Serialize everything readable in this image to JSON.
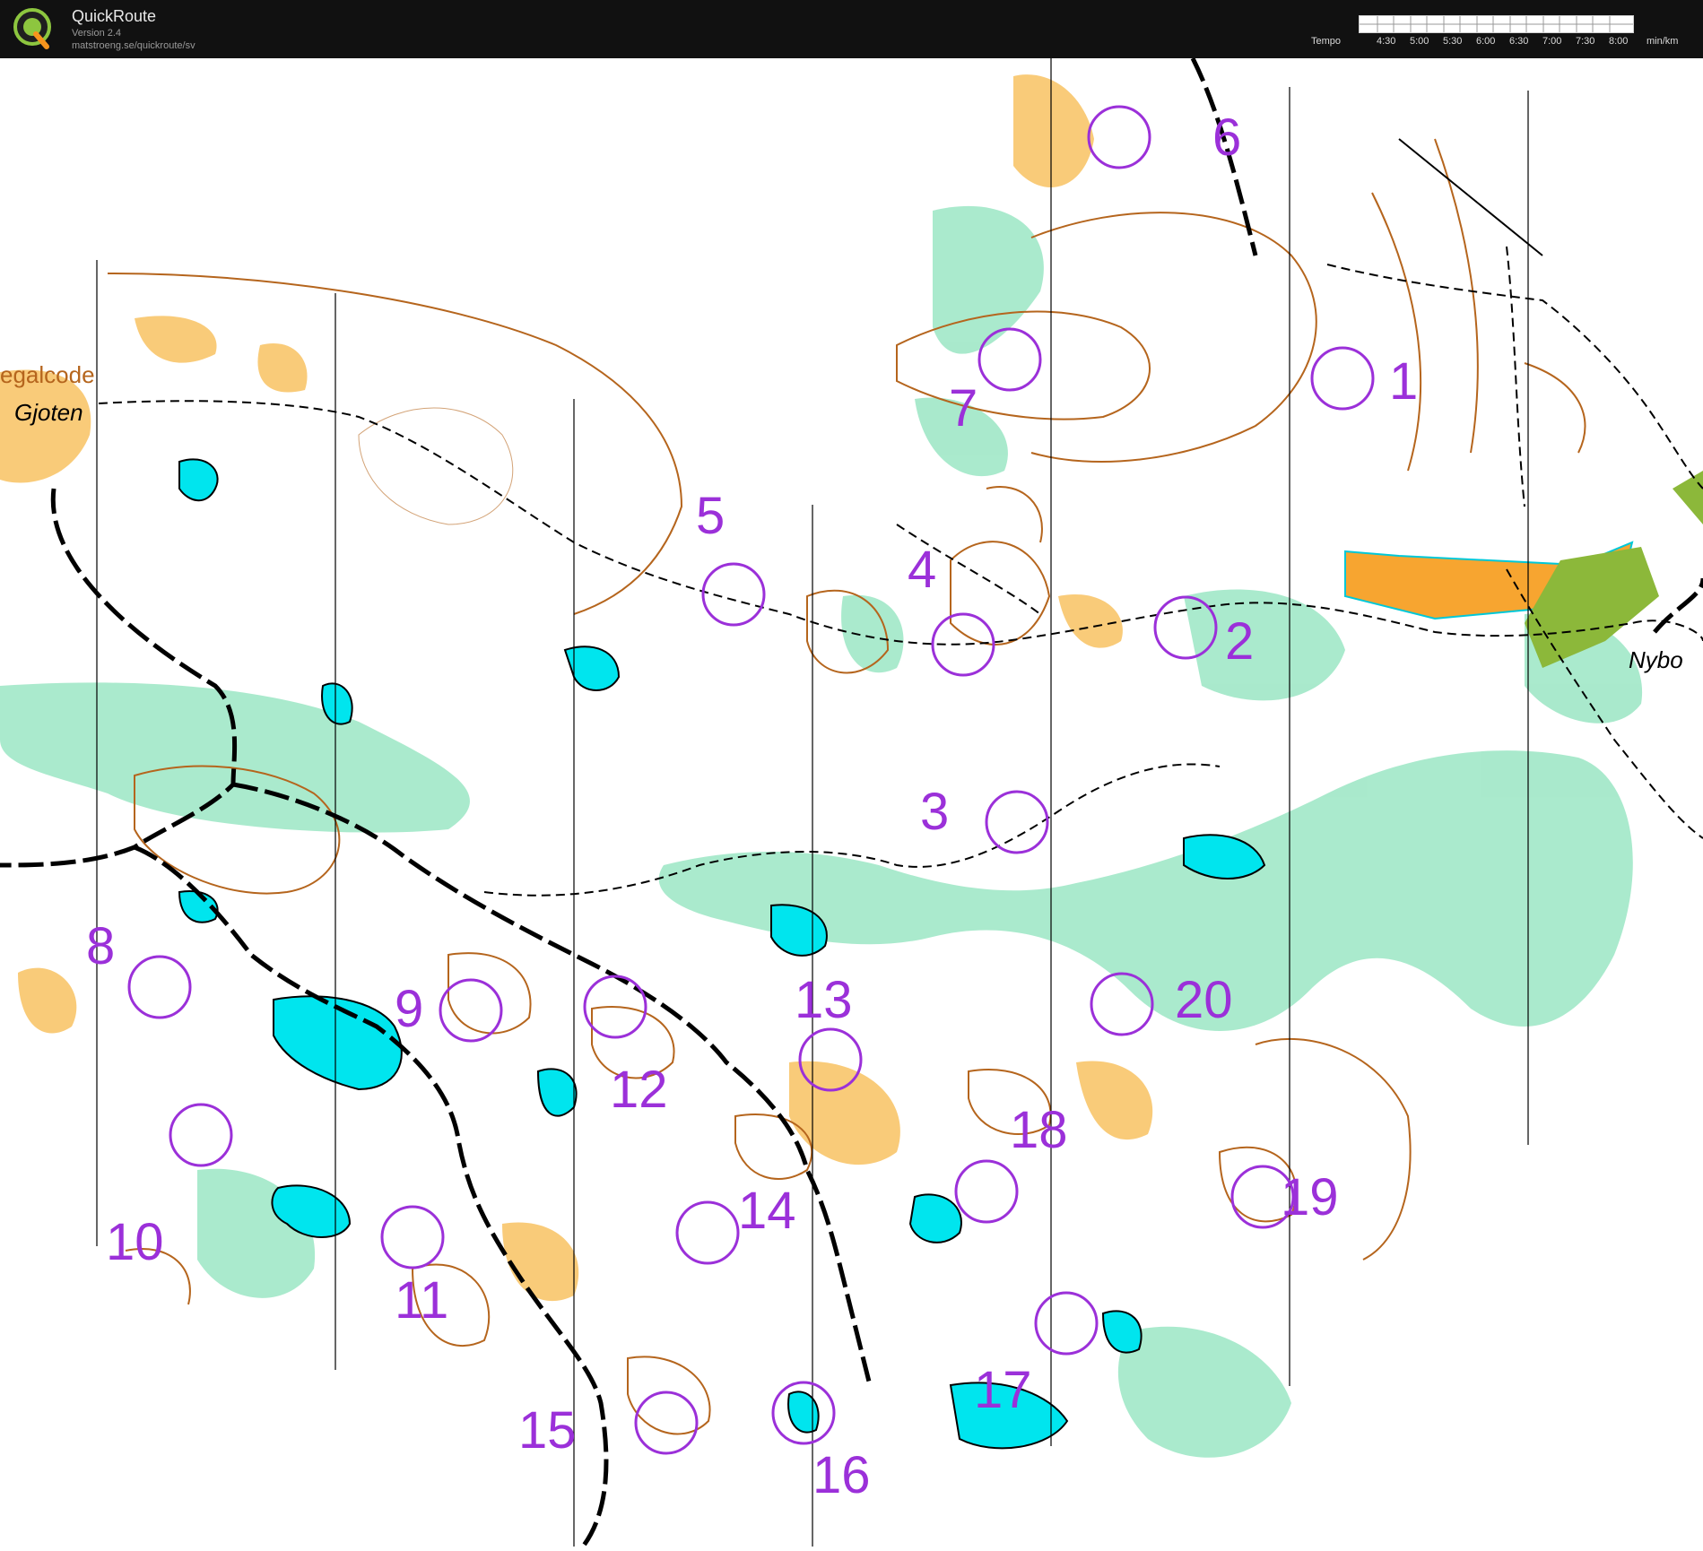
{
  "app": {
    "title": "QuickRoute",
    "version": "Version 2.4",
    "url": "matstroeng.se/quickroute/sv"
  },
  "tempo": {
    "label": "Tempo",
    "ticks": [
      "4:30",
      "5:00",
      "5:30",
      "6:00",
      "6:30",
      "7:00",
      "7:30",
      "8:00"
    ],
    "unit": "min/km"
  },
  "map": {
    "place_names": {
      "legalcode": "egalcode",
      "gjoten": "Gjoten",
      "nybo": "Nybo"
    },
    "controls": [
      "1",
      "2",
      "3",
      "4",
      "5",
      "6",
      "7",
      "8",
      "9",
      "10",
      "11",
      "12",
      "13",
      "14",
      "15",
      "16",
      "17",
      "18",
      "19",
      "20"
    ],
    "colors": {
      "control": "#9b30d9",
      "contour": "#b5651d",
      "water": "#00e5ee",
      "green": "#7fdcb4",
      "open": "#f7b24a",
      "track": "#000000"
    }
  }
}
